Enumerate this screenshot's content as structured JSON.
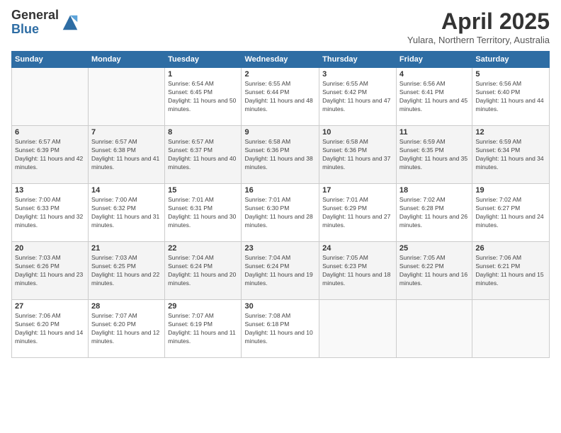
{
  "header": {
    "logo_line1": "General",
    "logo_line2": "Blue",
    "month": "April 2025",
    "location": "Yulara, Northern Territory, Australia"
  },
  "days_of_week": [
    "Sunday",
    "Monday",
    "Tuesday",
    "Wednesday",
    "Thursday",
    "Friday",
    "Saturday"
  ],
  "weeks": [
    [
      {
        "day": "",
        "info": ""
      },
      {
        "day": "",
        "info": ""
      },
      {
        "day": "1",
        "info": "Sunrise: 6:54 AM\nSunset: 6:45 PM\nDaylight: 11 hours and 50 minutes."
      },
      {
        "day": "2",
        "info": "Sunrise: 6:55 AM\nSunset: 6:44 PM\nDaylight: 11 hours and 48 minutes."
      },
      {
        "day": "3",
        "info": "Sunrise: 6:55 AM\nSunset: 6:42 PM\nDaylight: 11 hours and 47 minutes."
      },
      {
        "day": "4",
        "info": "Sunrise: 6:56 AM\nSunset: 6:41 PM\nDaylight: 11 hours and 45 minutes."
      },
      {
        "day": "5",
        "info": "Sunrise: 6:56 AM\nSunset: 6:40 PM\nDaylight: 11 hours and 44 minutes."
      }
    ],
    [
      {
        "day": "6",
        "info": "Sunrise: 6:57 AM\nSunset: 6:39 PM\nDaylight: 11 hours and 42 minutes."
      },
      {
        "day": "7",
        "info": "Sunrise: 6:57 AM\nSunset: 6:38 PM\nDaylight: 11 hours and 41 minutes."
      },
      {
        "day": "8",
        "info": "Sunrise: 6:57 AM\nSunset: 6:37 PM\nDaylight: 11 hours and 40 minutes."
      },
      {
        "day": "9",
        "info": "Sunrise: 6:58 AM\nSunset: 6:36 PM\nDaylight: 11 hours and 38 minutes."
      },
      {
        "day": "10",
        "info": "Sunrise: 6:58 AM\nSunset: 6:36 PM\nDaylight: 11 hours and 37 minutes."
      },
      {
        "day": "11",
        "info": "Sunrise: 6:59 AM\nSunset: 6:35 PM\nDaylight: 11 hours and 35 minutes."
      },
      {
        "day": "12",
        "info": "Sunrise: 6:59 AM\nSunset: 6:34 PM\nDaylight: 11 hours and 34 minutes."
      }
    ],
    [
      {
        "day": "13",
        "info": "Sunrise: 7:00 AM\nSunset: 6:33 PM\nDaylight: 11 hours and 32 minutes."
      },
      {
        "day": "14",
        "info": "Sunrise: 7:00 AM\nSunset: 6:32 PM\nDaylight: 11 hours and 31 minutes."
      },
      {
        "day": "15",
        "info": "Sunrise: 7:01 AM\nSunset: 6:31 PM\nDaylight: 11 hours and 30 minutes."
      },
      {
        "day": "16",
        "info": "Sunrise: 7:01 AM\nSunset: 6:30 PM\nDaylight: 11 hours and 28 minutes."
      },
      {
        "day": "17",
        "info": "Sunrise: 7:01 AM\nSunset: 6:29 PM\nDaylight: 11 hours and 27 minutes."
      },
      {
        "day": "18",
        "info": "Sunrise: 7:02 AM\nSunset: 6:28 PM\nDaylight: 11 hours and 26 minutes."
      },
      {
        "day": "19",
        "info": "Sunrise: 7:02 AM\nSunset: 6:27 PM\nDaylight: 11 hours and 24 minutes."
      }
    ],
    [
      {
        "day": "20",
        "info": "Sunrise: 7:03 AM\nSunset: 6:26 PM\nDaylight: 11 hours and 23 minutes."
      },
      {
        "day": "21",
        "info": "Sunrise: 7:03 AM\nSunset: 6:25 PM\nDaylight: 11 hours and 22 minutes."
      },
      {
        "day": "22",
        "info": "Sunrise: 7:04 AM\nSunset: 6:24 PM\nDaylight: 11 hours and 20 minutes."
      },
      {
        "day": "23",
        "info": "Sunrise: 7:04 AM\nSunset: 6:24 PM\nDaylight: 11 hours and 19 minutes."
      },
      {
        "day": "24",
        "info": "Sunrise: 7:05 AM\nSunset: 6:23 PM\nDaylight: 11 hours and 18 minutes."
      },
      {
        "day": "25",
        "info": "Sunrise: 7:05 AM\nSunset: 6:22 PM\nDaylight: 11 hours and 16 minutes."
      },
      {
        "day": "26",
        "info": "Sunrise: 7:06 AM\nSunset: 6:21 PM\nDaylight: 11 hours and 15 minutes."
      }
    ],
    [
      {
        "day": "27",
        "info": "Sunrise: 7:06 AM\nSunset: 6:20 PM\nDaylight: 11 hours and 14 minutes."
      },
      {
        "day": "28",
        "info": "Sunrise: 7:07 AM\nSunset: 6:20 PM\nDaylight: 11 hours and 12 minutes."
      },
      {
        "day": "29",
        "info": "Sunrise: 7:07 AM\nSunset: 6:19 PM\nDaylight: 11 hours and 11 minutes."
      },
      {
        "day": "30",
        "info": "Sunrise: 7:08 AM\nSunset: 6:18 PM\nDaylight: 11 hours and 10 minutes."
      },
      {
        "day": "",
        "info": ""
      },
      {
        "day": "",
        "info": ""
      },
      {
        "day": "",
        "info": ""
      }
    ]
  ]
}
